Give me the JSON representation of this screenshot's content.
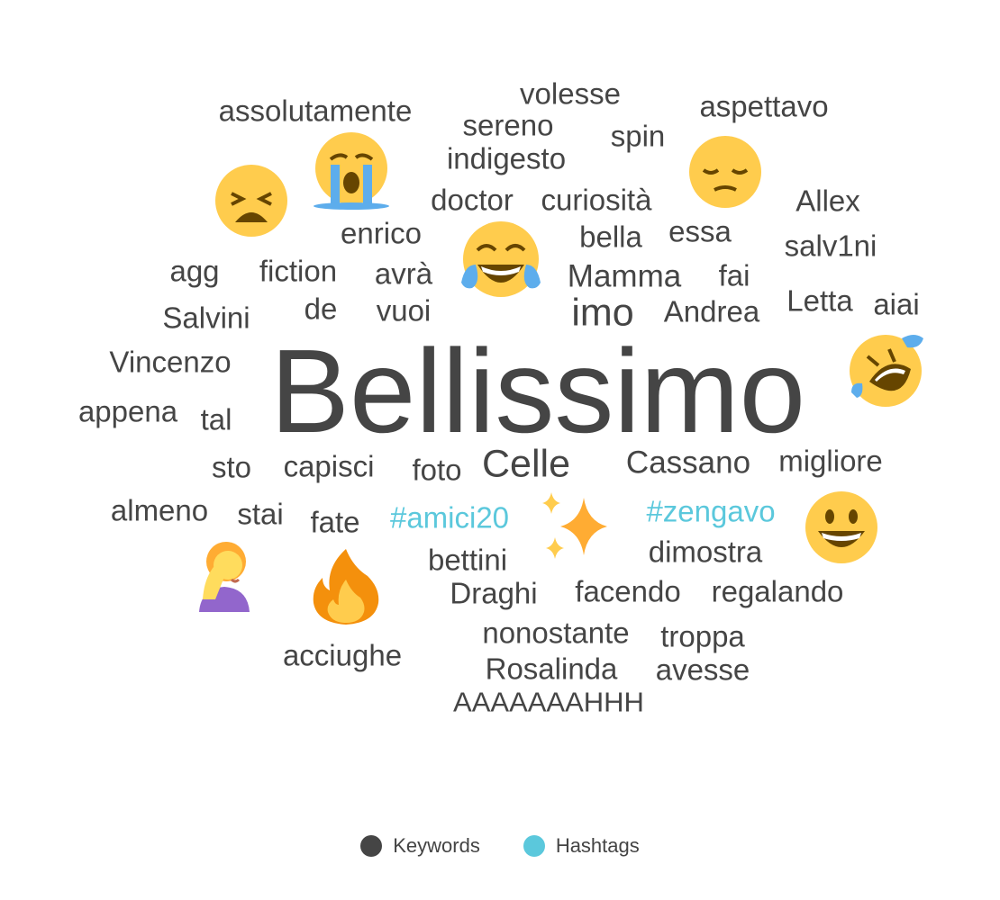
{
  "legend": {
    "keywords_label": "Keywords",
    "hashtags_label": "Hashtags",
    "keywords_color": "#454545",
    "hashtags_color": "#5bc8dc"
  },
  "words": [
    "Bellissimo",
    "volesse",
    "assolutamente",
    "sereno",
    "spin",
    "aspettavo",
    "indigesto",
    "doctor",
    "curiosità",
    "Allex",
    "enrico",
    "bella",
    "essa",
    "salv1ni",
    "agg",
    "fiction",
    "avrà",
    "Mamma",
    "fai",
    "Letta",
    "aiai",
    "de",
    "vuoi",
    "Salvini",
    "imo",
    "Andrea",
    "Vincenzo",
    "appena",
    "tal",
    "sto",
    "capisci",
    "foto",
    "Celle",
    "Cassano",
    "migliore",
    "almeno",
    "stai",
    "fate",
    "#amici20",
    "#zengavo",
    "bettini",
    "dimostra",
    "Draghi",
    "facendo",
    "regalando",
    "acciughe",
    "nonostante",
    "troppa",
    "Rosalinda",
    "avesse",
    "AAAAAAAHHH"
  ],
  "emojis": [
    "loudly-crying-face-icon",
    "weary-face-icon",
    "pensive-face-icon",
    "face-with-tears-of-joy-icon",
    "rolling-on-floor-laughing-icon",
    "sparkles-icon",
    "grinning-face-icon",
    "woman-facepalming-icon",
    "fire-icon"
  ]
}
